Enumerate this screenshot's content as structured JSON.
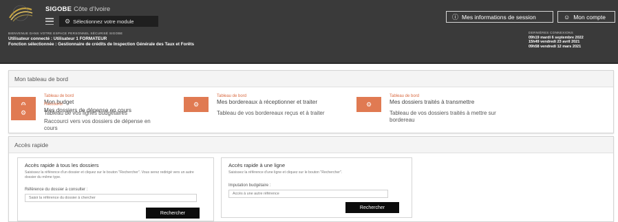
{
  "header": {
    "app_name": "SIGOBE",
    "country": "Côte d'Ivoire",
    "module_button": "Sélectionnez votre module",
    "session_button": "Mes informations de session",
    "account_button": "Mon compte",
    "welcome": "BIENVENUE DANS VOTRE ESPACE PERSONNEL SÉCURISÉ SIGOBE",
    "user_line": "Utilisateur connecté : Utilisateur 1 FORMATEUR",
    "function_line": "Fonction sélectionnée : Gestionnaire de crédits de Inspection Générale des Taux et Forêts",
    "last_connections_title": "DERNIÈRES CONNEXIONS",
    "last_connections": [
      "09h19 mardi 6 septembre 2022",
      "15h49 vendredi 23 avril 2021",
      "09h58 vendredi 12 mars 2021"
    ]
  },
  "dashboard": {
    "title": "Mon tableau de bord",
    "tiles": [
      {
        "category": "Tableau de bord",
        "title": "Mon budget",
        "description": "Tableau de vos lignes budgétaires"
      },
      {
        "category": "Tableau de bord",
        "title": "Mes bordereaux à réceptionner et traiter",
        "description": "Tableau de vos bordereaux reçus et à traiter"
      },
      {
        "category": "Tableau de bord",
        "title": "Mes dossiers traités à transmettre",
        "description": "Tableau de vos dossiers traités à mettre sur bordereau"
      },
      {
        "category": "Raccourci",
        "title": "Mes dossiers de dépense en cours",
        "description": "Raccourci vers vos dossiers de dépense en cours"
      }
    ]
  },
  "quick_access": {
    "title": "Accès rapide",
    "cards": [
      {
        "title": "Accès rapide à tous les dossiers",
        "description": "Saisissez la référence d'un dossier et cliquez sur le bouton \"Rechercher\". Vous serez redirigé vers un autre dossier du même type.",
        "label": "Référence du dossier à consulter :",
        "placeholder": "Saisir la référence du dossier à chercher",
        "button": "Rechercher"
      },
      {
        "title": "Accès rapide à une ligne",
        "description": "Saisissez la référence d'une ligne et cliquez sur le bouton \"Rechercher\".",
        "label": "Imputation budgétaire :",
        "placeholder": "Accès à une autre référence",
        "button": "Rechercher"
      }
    ]
  },
  "colors": {
    "header_bg": "#3a3a3a",
    "accent": "#e07a52",
    "button_bg": "#0c0c0c"
  },
  "icons": {
    "tile": "gear-icon",
    "module": "gear-icon",
    "session": "info-icon",
    "account": "user-icon"
  }
}
